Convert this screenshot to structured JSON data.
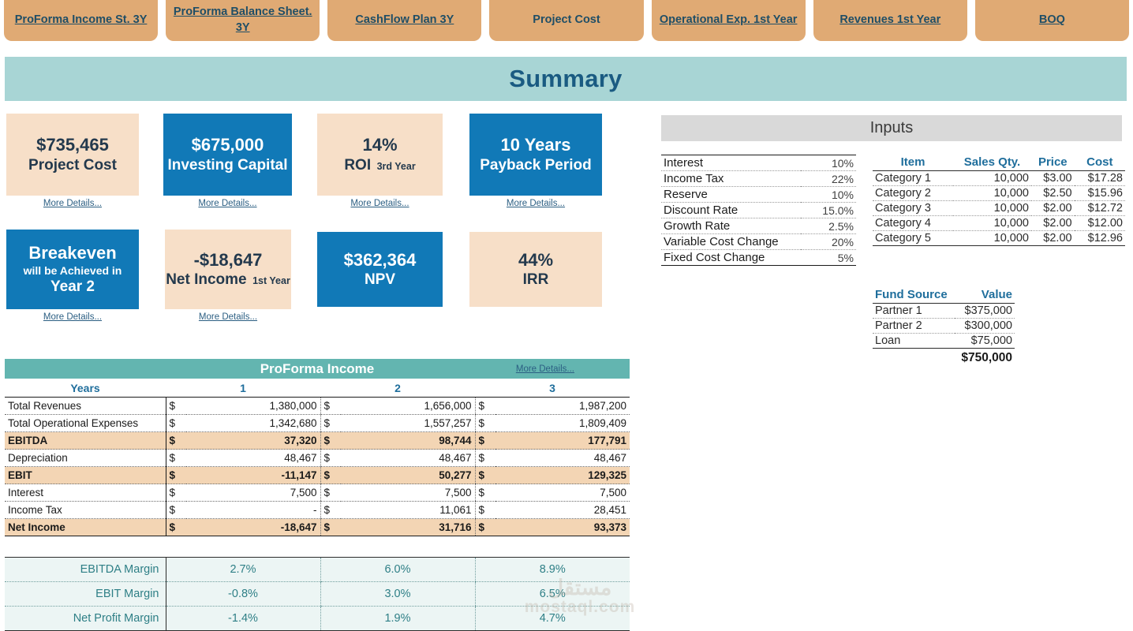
{
  "nav": {
    "tabs": [
      {
        "label": "ProForma Income St. 3Y",
        "is_link": true
      },
      {
        "label": "ProForma Balance Sheet. 3Y",
        "is_link": true
      },
      {
        "label": "CashFlow Plan 3Y",
        "is_link": true
      },
      {
        "label": "Project Cost",
        "is_link": false
      },
      {
        "label": "Operational Exp. 1st Year",
        "is_link": true
      },
      {
        "label": "Revenues 1st Year",
        "is_link": true
      },
      {
        "label": "BOQ",
        "is_link": true
      }
    ]
  },
  "summary": {
    "title": "Summary"
  },
  "more_details_label": "More Details...",
  "kpis": [
    {
      "value": "$735,465",
      "label": "Project Cost",
      "sub": "",
      "mid": "",
      "style": "peach",
      "has_more": true
    },
    {
      "value": "$675,000",
      "label": "Investing Capital",
      "sub": "",
      "mid": "",
      "style": "blue",
      "has_more": true
    },
    {
      "value": "14%",
      "label": "ROI",
      "sub": "3rd Year",
      "mid": "",
      "style": "peach",
      "has_more": true
    },
    {
      "value": "10 Years",
      "label": "Payback Period",
      "sub": "",
      "mid": "",
      "style": "blue",
      "has_more": true
    },
    {
      "value": "Breakeven",
      "label": "Year 2",
      "sub": "",
      "mid": "will be Achieved in",
      "style": "blue",
      "has_more": true
    },
    {
      "value": "-$18,647",
      "label": "Net Income",
      "sub": "1st Year",
      "mid": "",
      "style": "peach",
      "has_more": true
    },
    {
      "value": "$362,364",
      "label": "NPV",
      "sub": "",
      "mid": "",
      "style": "blue",
      "has_more": false
    },
    {
      "value": "44%",
      "label": "IRR",
      "sub": "",
      "mid": "",
      "style": "peach",
      "has_more": false
    }
  ],
  "inputs": {
    "title": "Inputs",
    "params": [
      {
        "name": "Interest",
        "value": "10%"
      },
      {
        "name": "Income Tax",
        "value": "22%"
      },
      {
        "name": "Reserve",
        "value": "10%"
      },
      {
        "name": "Discount Rate",
        "value": "15.0%"
      },
      {
        "name": "Growth Rate",
        "value": "2.5%"
      },
      {
        "name": "Variable Cost Change",
        "value": "20%"
      },
      {
        "name": "Fixed Cost Change",
        "value": "5%"
      }
    ],
    "categories": {
      "headers": [
        "Item",
        "Sales Qty.",
        "Price",
        "Cost"
      ],
      "rows": [
        [
          "Category 1",
          "10,000",
          "$3.00",
          "$17.28"
        ],
        [
          "Category 2",
          "10,000",
          "$2.50",
          "$15.96"
        ],
        [
          "Category 3",
          "10,000",
          "$2.00",
          "$12.72"
        ],
        [
          "Category 4",
          "10,000",
          "$2.00",
          "$12.00"
        ],
        [
          "Category 5",
          "10,000",
          "$2.00",
          "$12.96"
        ]
      ]
    },
    "funding": {
      "headers": [
        "Fund Source",
        "Value"
      ],
      "rows": [
        [
          "Partner 1",
          "$375,000"
        ],
        [
          "Partner 2",
          "$300,000"
        ],
        [
          "Loan",
          "$75,000"
        ]
      ],
      "total": "$750,000"
    }
  },
  "proforma": {
    "title": "ProForma Income",
    "more_details": "More Details...",
    "years_label": "Years",
    "years": [
      "1",
      "2",
      "3"
    ],
    "currency": "$",
    "rows": [
      {
        "label": "Total Revenues",
        "values": [
          "1,380,000",
          "1,656,000",
          "1,987,200"
        ],
        "highlight": false
      },
      {
        "label": "Total Operational Expenses",
        "values": [
          "1,342,680",
          "1,557,257",
          "1,809,409"
        ],
        "highlight": false
      },
      {
        "label": "EBITDA",
        "values": [
          "37,320",
          "98,744",
          "177,791"
        ],
        "highlight": true
      },
      {
        "label": "Depreciation",
        "values": [
          "48,467",
          "48,467",
          "48,467"
        ],
        "highlight": false
      },
      {
        "label": "EBIT",
        "values": [
          "-11,147",
          "50,277",
          "129,325"
        ],
        "highlight": true
      },
      {
        "label": "Interest",
        "values": [
          "7,500",
          "7,500",
          "7,500"
        ],
        "highlight": false
      },
      {
        "label": "Income Tax",
        "values": [
          "-",
          "11,061",
          "28,451"
        ],
        "highlight": false
      },
      {
        "label": "Net Income",
        "values": [
          "-18,647",
          "31,716",
          "93,373"
        ],
        "highlight": true
      }
    ]
  },
  "margins": {
    "rows": [
      {
        "label": "EBITDA Margin",
        "values": [
          "2.7%",
          "6.0%",
          "8.9%"
        ]
      },
      {
        "label": "EBIT Margin",
        "values": [
          "-0.8%",
          "3.0%",
          "6.5%"
        ]
      },
      {
        "label": "Net Profit Margin",
        "values": [
          "-1.4%",
          "1.9%",
          "4.7%"
        ]
      }
    ]
  },
  "watermark": {
    "line1": "مستقل",
    "line2": "mostaql.com"
  },
  "colors": {
    "tab_orange": "#e0aa74",
    "banner_teal": "#a8d5d5",
    "card_blue": "#1179b7",
    "card_peach": "#f7dfc8",
    "table_teal": "#63b5b0",
    "row_highlight": "#f3d5b4",
    "inputs_gray": "#d9d9d9",
    "link_blue": "#2c5f83",
    "margin_bg": "#ecf5f4",
    "margin_text": "#2e7f86"
  }
}
